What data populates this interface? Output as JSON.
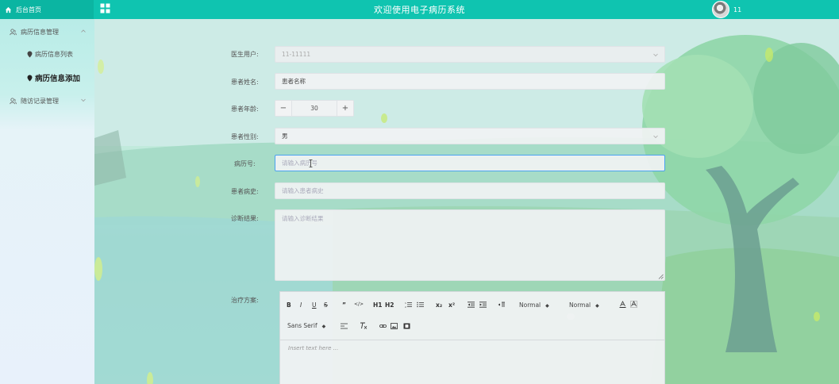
{
  "topbar": {
    "home_label": "后台首页",
    "title": "欢迎使用电子病历系统",
    "username": "11",
    "bg_color": "#0fc4b0"
  },
  "sidebar": {
    "items": [
      {
        "label": "病历信息管理",
        "icon": "user-group-icon",
        "expanded": true
      },
      {
        "label": "病历信息列表",
        "icon": "pin-icon"
      },
      {
        "label": "病历信息添加",
        "icon": "pin-icon",
        "active": true
      },
      {
        "label": "随访记录管理",
        "icon": "user-group-icon",
        "expanded": false
      }
    ]
  },
  "form": {
    "doctor_user": {
      "label": "医生用户:",
      "value": "11-11111"
    },
    "patient_name": {
      "label": "患者姓名:",
      "value": "患者名称"
    },
    "patient_age": {
      "label": "患者年龄:",
      "value": "30",
      "minus": "−",
      "plus": "+"
    },
    "patient_gender": {
      "label": "患者性别:",
      "value": "男"
    },
    "record_no": {
      "label": "病历号:",
      "placeholder": "请输入病历号"
    },
    "history": {
      "label": "患者病史:",
      "placeholder": "请输入患者病史"
    },
    "diagnosis": {
      "label": "诊断结果:",
      "placeholder": "请输入诊断结果"
    },
    "treatment": {
      "label": "治疗方案:"
    }
  },
  "editor": {
    "toolbar": {
      "bold": "B",
      "italic": "I",
      "underline": "U",
      "strike": "S",
      "blockquote": "”",
      "code": "</>",
      "h1": "H1",
      "h2": "H2",
      "ordered_list": "ol",
      "bullet_list": "ul",
      "subscript": "x₂",
      "superscript": "x²",
      "size_picker": "Normal",
      "header_picker": "Normal",
      "font_picker": "Sans Serif"
    },
    "placeholder": "Insert text here ..."
  },
  "colors": {
    "accent": "#0fc4b0",
    "focus": "#4aa2f0"
  }
}
